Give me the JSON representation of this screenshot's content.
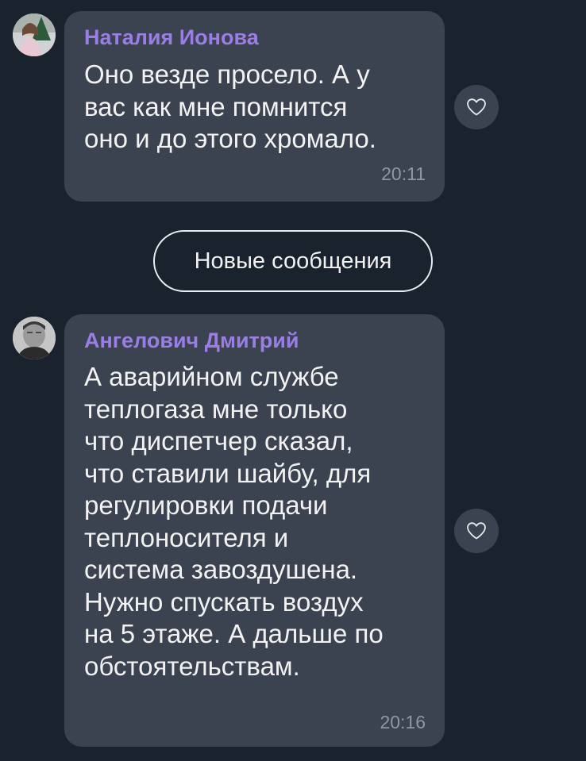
{
  "colors": {
    "background": "#1a222d",
    "bubble": "#3b4350",
    "sender_name": "#9b7de6",
    "message_text": "#f2f2f2",
    "timestamp": "#8f97a3"
  },
  "messages": [
    {
      "sender": "Наталия Ионова",
      "text": "Оно везде просело. А у\nвас как мне помнится\nоно и до этого хромало.",
      "time": "20:11",
      "avatar": "avatar-photo",
      "reaction_icon": "heart-outline-icon"
    },
    {
      "sender": "Ангелович Дмитрий",
      "text": "А аварийном службе\nтеплогаза мне только\nчто диспетчер сказал,\nчто ставили шайбу, для\nрегулировки подачи\nтеплоносителя и\nсистема завоздушена.\nНужно спускать воздух\nна 5 этаже. А дальше по\nобстоятельствам.",
      "time": "20:16",
      "avatar": "avatar-photo",
      "reaction_icon": "heart-outline-icon"
    }
  ],
  "new_messages_divider": {
    "label": "Новые сообщения"
  }
}
